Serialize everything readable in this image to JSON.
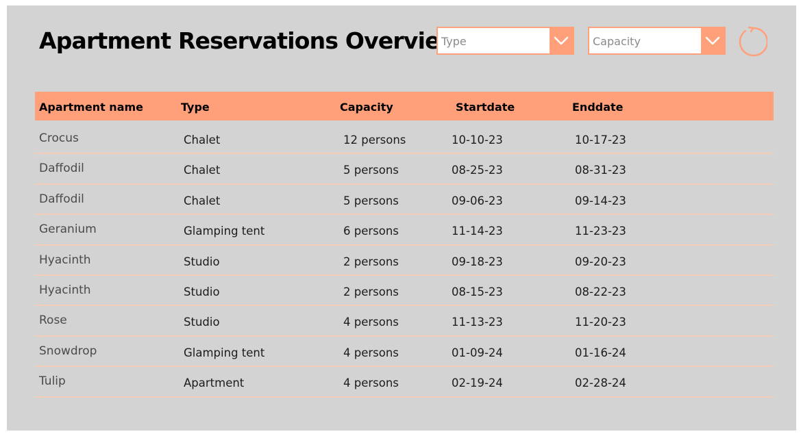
{
  "page": {
    "title": "Apartment Reservations Overview"
  },
  "filters": {
    "type_placeholder": "Type",
    "capacity_placeholder": "Capacity"
  },
  "table": {
    "headers": [
      "Apartment name",
      "Type",
      "Capacity",
      "Startdate",
      "Enddate"
    ],
    "rows": [
      [
        "Crocus",
        "Chalet",
        "12 persons",
        "10-10-23",
        "10-17-23"
      ],
      [
        "Daffodil",
        "Chalet",
        "5 persons",
        "08-25-23",
        "08-31-23"
      ],
      [
        "Daffodil",
        "Chalet",
        "5 persons",
        "09-06-23",
        "09-14-23"
      ],
      [
        "Geranium",
        "Glamping tent",
        "6 persons",
        "11-14-23",
        "11-23-23"
      ],
      [
        "Hyacinth",
        "Studio",
        "2 persons",
        "09-18-23",
        "09-20-23"
      ],
      [
        "Hyacinth",
        "Studio",
        "2 persons",
        "08-15-23",
        "08-22-23"
      ],
      [
        "Rose",
        "Studio",
        "4 persons",
        "11-13-23",
        "11-20-23"
      ],
      [
        "Snowdrop",
        "Glamping tent",
        "4 persons",
        "01-09-24",
        "01-16-24"
      ],
      [
        "Tulip",
        "Apartment",
        "4 persons",
        "02-19-24",
        "02-28-24"
      ]
    ]
  },
  "icons": {
    "dropdown": "chevron-down-icon",
    "refresh": "refresh-icon"
  },
  "colors": {
    "accent": "#ffa07a",
    "background": "#d3d3d3",
    "row_divider": "#f2cdb8"
  }
}
